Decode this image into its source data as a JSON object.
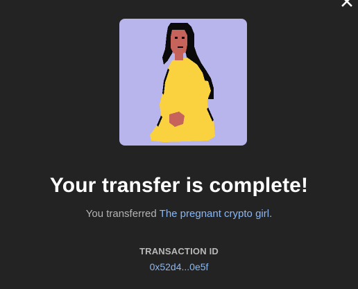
{
  "modal": {
    "close_icon": "close-icon",
    "nft": {
      "background_color": "#b8b4ec",
      "dress_color": "#fad13e",
      "skin_color": "#c6635a",
      "hair_color": "#000000"
    },
    "headline": "Your transfer is complete!",
    "message_prefix": "You transferred ",
    "item_name": "The pregnant crypto girl",
    "message_suffix": ".",
    "transaction": {
      "label": "TRANSACTION ID",
      "id": "0x52d4...0e5f"
    },
    "colors": {
      "background": "#232323",
      "link": "#8cb7f2"
    }
  }
}
